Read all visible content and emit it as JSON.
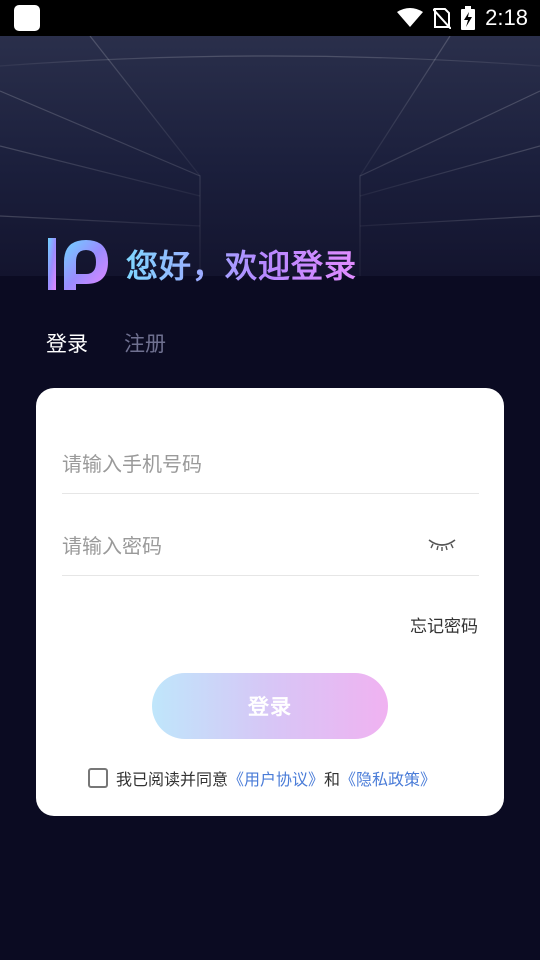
{
  "status_bar": {
    "time": "2:18",
    "icons": [
      "app-notification-icon",
      "wifi-icon",
      "no-sim-icon",
      "battery-charging-icon"
    ]
  },
  "header": {
    "logo": "p-logo-icon",
    "greeting": "您好，欢迎登录"
  },
  "tabs": [
    {
      "label": "登录",
      "active": true
    },
    {
      "label": "注册",
      "active": false
    }
  ],
  "form": {
    "phone_placeholder": "请输入手机号码",
    "password_placeholder": "请输入密码",
    "password_toggle_icon": "eye-closed-icon",
    "forgot_password": "忘记密码",
    "login_button": "登录"
  },
  "agreement": {
    "prefix": "我已阅读并同意",
    "user_agreement": "《用户协议》",
    "conjunction": "和",
    "privacy_policy": "《隐私政策》",
    "checked": false
  },
  "colors": {
    "background": "#0b0b22",
    "accent_blue": "#7fd6ff",
    "accent_purple": "#e28cff",
    "link": "#4a7cd8"
  }
}
